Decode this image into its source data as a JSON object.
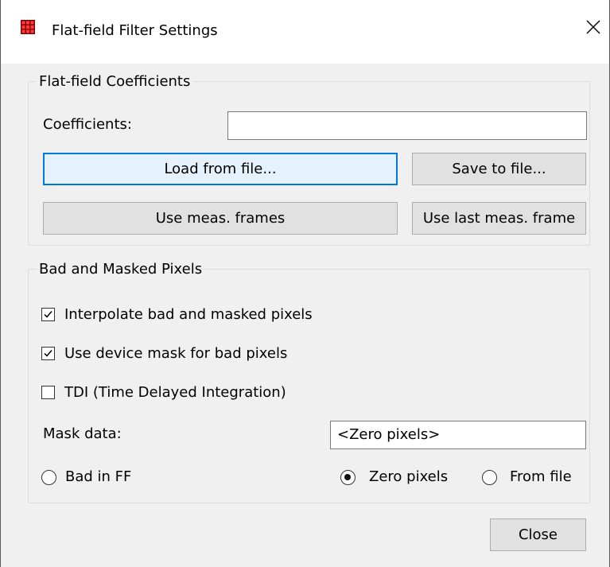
{
  "window": {
    "title": "Flat-field Filter Settings"
  },
  "coefficients_group": {
    "legend": "Flat-field Coefficients",
    "coefficients_label": "Coefficients:",
    "coefficients_value": "",
    "load_button": "Load from file...",
    "save_button": "Save to file...",
    "use_meas_frames_button": "Use meas. frames",
    "use_last_meas_frame_button": "Use last meas. frame"
  },
  "pixels_group": {
    "legend": "Bad and Masked Pixels",
    "interpolate_label": "Interpolate bad and masked pixels",
    "interpolate_checked": true,
    "device_mask_label": "Use device mask for bad pixels",
    "device_mask_checked": true,
    "tdi_label": "TDI (Time Delayed Integration)",
    "tdi_checked": false,
    "mask_data_label": "Mask data:",
    "mask_data_value": "<Zero pixels>",
    "radio_bad_in_ff": "Bad in FF",
    "radio_zero_pixels": "Zero pixels",
    "radio_from_file": "From file",
    "selected_radio": "Zero pixels"
  },
  "footer": {
    "close_button": "Close"
  },
  "colors": {
    "focus_border": "#0078d7",
    "button_bg": "#e1e1e1",
    "dialog_bg": "#f0f0f0"
  }
}
